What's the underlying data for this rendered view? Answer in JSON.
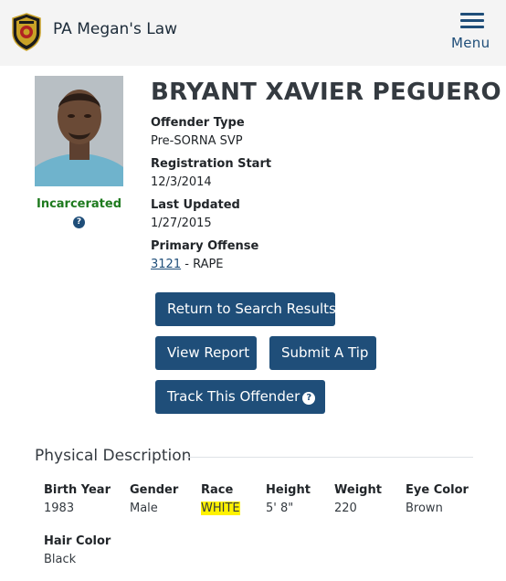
{
  "header": {
    "site_title": "PA Megan's Law",
    "menu_label": "Menu",
    "logo_icon": "pa-state-police-seal-icon",
    "colors": {
      "brand": "#1f4e79",
      "status_green": "#1e7a1e",
      "highlight": "#fff200"
    }
  },
  "offender": {
    "name": "BRYANT XAVIER PEGUERO",
    "status": "Incarcerated",
    "fields": [
      {
        "label": "Offender Type",
        "value": "Pre-SORNA SVP"
      },
      {
        "label": "Registration Start",
        "value": "12/3/2014"
      },
      {
        "label": "Last Updated",
        "value": "1/27/2015"
      },
      {
        "label": "Primary Offense",
        "code": "3121",
        "separator": " - ",
        "description": "RAPE"
      }
    ]
  },
  "actions": {
    "return_label": "Return to Search Results",
    "view_report_label": "View Report",
    "submit_tip_label": "Submit A Tip",
    "track_label": "Track This Offender"
  },
  "physical": {
    "title": "Physical Description",
    "attributes": [
      {
        "label": "Birth Year",
        "value": "1983"
      },
      {
        "label": "Gender",
        "value": "Male"
      },
      {
        "label": "Race",
        "value": "WHITE"
      },
      {
        "label": "Height",
        "value": "5' 8\""
      },
      {
        "label": "Weight",
        "value": "220"
      },
      {
        "label": "Eye Color",
        "value": "Brown"
      },
      {
        "label": "Hair Color",
        "value": "Black"
      }
    ]
  }
}
